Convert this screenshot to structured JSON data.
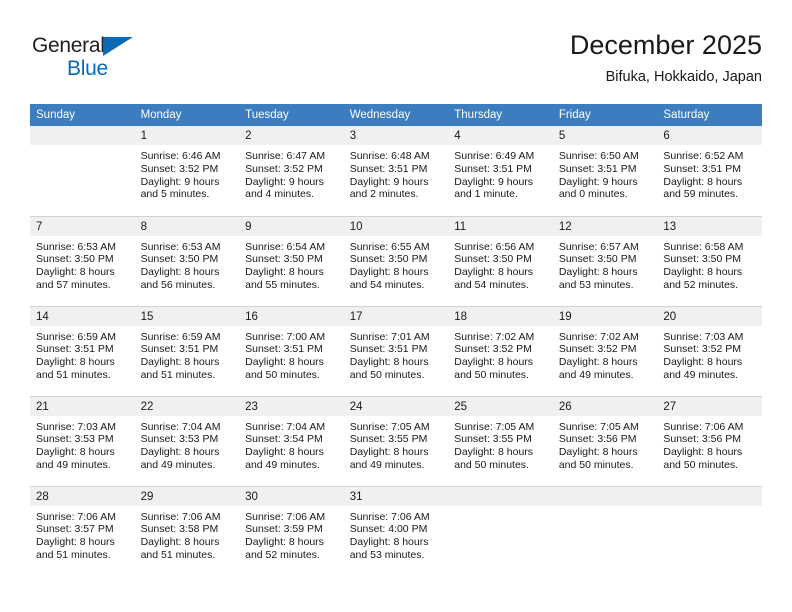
{
  "brand": {
    "name_part1": "General",
    "name_part2": "Blue",
    "triangle_color": "#0a6ab5"
  },
  "header": {
    "title": "December 2025",
    "subtitle": "Bifuka, Hokkaido, Japan"
  },
  "theme": {
    "header_row_background": "#3b7dbf",
    "header_row_text": "#ffffff",
    "daynumber_band": "#f0f0f0",
    "grid_line": "#d2d2d2",
    "body_text": "#1a1a1a"
  },
  "weekdays": [
    "Sunday",
    "Monday",
    "Tuesday",
    "Wednesday",
    "Thursday",
    "Friday",
    "Saturday"
  ],
  "weeks": [
    [
      {
        "day": "",
        "lines": []
      },
      {
        "day": "1",
        "lines": [
          "Sunrise: 6:46 AM",
          "Sunset: 3:52 PM",
          "Daylight: 9 hours",
          "and 5 minutes."
        ]
      },
      {
        "day": "2",
        "lines": [
          "Sunrise: 6:47 AM",
          "Sunset: 3:52 PM",
          "Daylight: 9 hours",
          "and 4 minutes."
        ]
      },
      {
        "day": "3",
        "lines": [
          "Sunrise: 6:48 AM",
          "Sunset: 3:51 PM",
          "Daylight: 9 hours",
          "and 2 minutes."
        ]
      },
      {
        "day": "4",
        "lines": [
          "Sunrise: 6:49 AM",
          "Sunset: 3:51 PM",
          "Daylight: 9 hours",
          "and 1 minute."
        ]
      },
      {
        "day": "5",
        "lines": [
          "Sunrise: 6:50 AM",
          "Sunset: 3:51 PM",
          "Daylight: 9 hours",
          "and 0 minutes."
        ]
      },
      {
        "day": "6",
        "lines": [
          "Sunrise: 6:52 AM",
          "Sunset: 3:51 PM",
          "Daylight: 8 hours",
          "and 59 minutes."
        ]
      }
    ],
    [
      {
        "day": "7",
        "lines": [
          "Sunrise: 6:53 AM",
          "Sunset: 3:50 PM",
          "Daylight: 8 hours",
          "and 57 minutes."
        ]
      },
      {
        "day": "8",
        "lines": [
          "Sunrise: 6:53 AM",
          "Sunset: 3:50 PM",
          "Daylight: 8 hours",
          "and 56 minutes."
        ]
      },
      {
        "day": "9",
        "lines": [
          "Sunrise: 6:54 AM",
          "Sunset: 3:50 PM",
          "Daylight: 8 hours",
          "and 55 minutes."
        ]
      },
      {
        "day": "10",
        "lines": [
          "Sunrise: 6:55 AM",
          "Sunset: 3:50 PM",
          "Daylight: 8 hours",
          "and 54 minutes."
        ]
      },
      {
        "day": "11",
        "lines": [
          "Sunrise: 6:56 AM",
          "Sunset: 3:50 PM",
          "Daylight: 8 hours",
          "and 54 minutes."
        ]
      },
      {
        "day": "12",
        "lines": [
          "Sunrise: 6:57 AM",
          "Sunset: 3:50 PM",
          "Daylight: 8 hours",
          "and 53 minutes."
        ]
      },
      {
        "day": "13",
        "lines": [
          "Sunrise: 6:58 AM",
          "Sunset: 3:50 PM",
          "Daylight: 8 hours",
          "and 52 minutes."
        ]
      }
    ],
    [
      {
        "day": "14",
        "lines": [
          "Sunrise: 6:59 AM",
          "Sunset: 3:51 PM",
          "Daylight: 8 hours",
          "and 51 minutes."
        ]
      },
      {
        "day": "15",
        "lines": [
          "Sunrise: 6:59 AM",
          "Sunset: 3:51 PM",
          "Daylight: 8 hours",
          "and 51 minutes."
        ]
      },
      {
        "day": "16",
        "lines": [
          "Sunrise: 7:00 AM",
          "Sunset: 3:51 PM",
          "Daylight: 8 hours",
          "and 50 minutes."
        ]
      },
      {
        "day": "17",
        "lines": [
          "Sunrise: 7:01 AM",
          "Sunset: 3:51 PM",
          "Daylight: 8 hours",
          "and 50 minutes."
        ]
      },
      {
        "day": "18",
        "lines": [
          "Sunrise: 7:02 AM",
          "Sunset: 3:52 PM",
          "Daylight: 8 hours",
          "and 50 minutes."
        ]
      },
      {
        "day": "19",
        "lines": [
          "Sunrise: 7:02 AM",
          "Sunset: 3:52 PM",
          "Daylight: 8 hours",
          "and 49 minutes."
        ]
      },
      {
        "day": "20",
        "lines": [
          "Sunrise: 7:03 AM",
          "Sunset: 3:52 PM",
          "Daylight: 8 hours",
          "and 49 minutes."
        ]
      }
    ],
    [
      {
        "day": "21",
        "lines": [
          "Sunrise: 7:03 AM",
          "Sunset: 3:53 PM",
          "Daylight: 8 hours",
          "and 49 minutes."
        ]
      },
      {
        "day": "22",
        "lines": [
          "Sunrise: 7:04 AM",
          "Sunset: 3:53 PM",
          "Daylight: 8 hours",
          "and 49 minutes."
        ]
      },
      {
        "day": "23",
        "lines": [
          "Sunrise: 7:04 AM",
          "Sunset: 3:54 PM",
          "Daylight: 8 hours",
          "and 49 minutes."
        ]
      },
      {
        "day": "24",
        "lines": [
          "Sunrise: 7:05 AM",
          "Sunset: 3:55 PM",
          "Daylight: 8 hours",
          "and 49 minutes."
        ]
      },
      {
        "day": "25",
        "lines": [
          "Sunrise: 7:05 AM",
          "Sunset: 3:55 PM",
          "Daylight: 8 hours",
          "and 50 minutes."
        ]
      },
      {
        "day": "26",
        "lines": [
          "Sunrise: 7:05 AM",
          "Sunset: 3:56 PM",
          "Daylight: 8 hours",
          "and 50 minutes."
        ]
      },
      {
        "day": "27",
        "lines": [
          "Sunrise: 7:06 AM",
          "Sunset: 3:56 PM",
          "Daylight: 8 hours",
          "and 50 minutes."
        ]
      }
    ],
    [
      {
        "day": "28",
        "lines": [
          "Sunrise: 7:06 AM",
          "Sunset: 3:57 PM",
          "Daylight: 8 hours",
          "and 51 minutes."
        ]
      },
      {
        "day": "29",
        "lines": [
          "Sunrise: 7:06 AM",
          "Sunset: 3:58 PM",
          "Daylight: 8 hours",
          "and 51 minutes."
        ]
      },
      {
        "day": "30",
        "lines": [
          "Sunrise: 7:06 AM",
          "Sunset: 3:59 PM",
          "Daylight: 8 hours",
          "and 52 minutes."
        ]
      },
      {
        "day": "31",
        "lines": [
          "Sunrise: 7:06 AM",
          "Sunset: 4:00 PM",
          "Daylight: 8 hours",
          "and 53 minutes."
        ]
      },
      {
        "day": "",
        "lines": []
      },
      {
        "day": "",
        "lines": []
      },
      {
        "day": "",
        "lines": []
      }
    ]
  ]
}
